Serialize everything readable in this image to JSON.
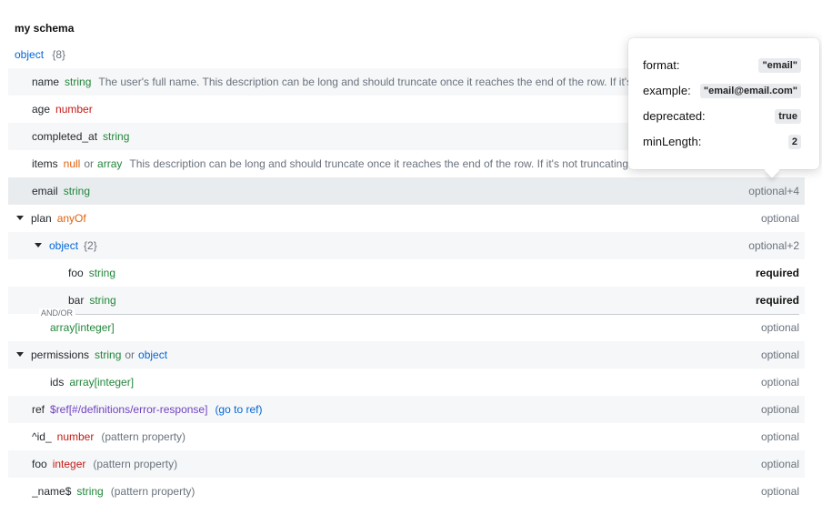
{
  "schema": {
    "title": "my schema",
    "root_type": "object",
    "root_count": "{8}"
  },
  "rows": {
    "name": {
      "name": "name",
      "type": "string",
      "desc": "The user's full name. This description can be long and should truncate once it reaches the end of the row. If it's not truncating then there's an issue that needs to be investigated and resolved."
    },
    "age": {
      "name": "age",
      "type": "number"
    },
    "completed": {
      "name": "completed_at",
      "type": "string"
    },
    "items": {
      "name": "items",
      "type1": "null",
      "or": "or",
      "type2": "array",
      "desc": "This description can be long and should truncate once it reaches the end of the row. If it's not truncating then there's an issue that needs to be investigated and resolved."
    },
    "email": {
      "name": "email",
      "type": "string",
      "req": "optional+4"
    },
    "plan": {
      "name": "plan",
      "type": "anyOf",
      "req": "optional"
    },
    "plan_obj": {
      "type": "object",
      "count": "{2}",
      "req": "optional+2"
    },
    "foo_inner": {
      "name": "foo",
      "type": "string",
      "req": "required"
    },
    "bar_inner": {
      "name": "bar",
      "type": "string",
      "req": "required"
    },
    "andor": {
      "label": "AND/OR"
    },
    "plan_arr": {
      "type": "array[integer]",
      "req": "optional"
    },
    "permissions": {
      "name": "permissions",
      "type1": "string",
      "or": "or",
      "type2": "object",
      "req": "optional"
    },
    "ids": {
      "name": "ids",
      "type": "array[integer]",
      "req": "optional"
    },
    "ref": {
      "name": "ref",
      "type": "$ref[#/definitions/error-response]",
      "link": "(go to ref)",
      "req": "optional"
    },
    "id_pat": {
      "name": "^id_",
      "type": "number",
      "note": "(pattern property)",
      "req": "optional"
    },
    "foo": {
      "name": "foo",
      "type": "integer",
      "note": "(pattern property)",
      "req": "optional"
    },
    "name_pat": {
      "name": "_name$",
      "type": "string",
      "note": "(pattern property)",
      "req": "optional"
    }
  },
  "popover": {
    "format": {
      "label": "format:",
      "value": "\"email\""
    },
    "example": {
      "label": "example:",
      "value": "\"email@email.com\""
    },
    "deprecated": {
      "label": "deprecated:",
      "value": "true"
    },
    "minLength": {
      "label": "minLength:",
      "value": "2"
    }
  }
}
